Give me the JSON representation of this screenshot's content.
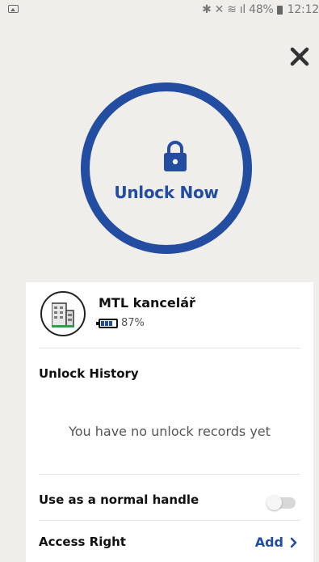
{
  "status_bar": {
    "battery_pct": "48%",
    "time": "12:12"
  },
  "unlock": {
    "label": "Unlock Now",
    "ring_color": "#234da1"
  },
  "device": {
    "name": "MTL kancelář",
    "battery": "87%",
    "battery_level": 0.87
  },
  "history": {
    "title": "Unlock History",
    "empty_text": "You have no unlock records yet"
  },
  "settings": {
    "normal_handle_label": "Use as a normal handle",
    "normal_handle_enabled": false
  },
  "access_right": {
    "title": "Access Right",
    "add_label": "Add"
  },
  "icons": {
    "close": "close-icon",
    "lock": "lock-icon",
    "building": "building-icon",
    "chevron": "chevron-right-icon"
  }
}
